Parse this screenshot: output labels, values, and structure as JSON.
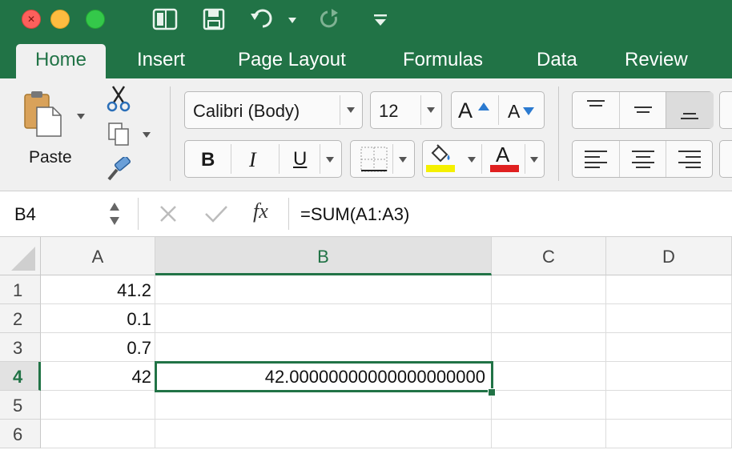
{
  "window": {
    "controls": [
      "close",
      "minimize",
      "maximize"
    ],
    "quick_access": [
      "sidebar-toggle-icon",
      "save-icon",
      "undo-icon",
      "redo-icon",
      "customize-icon"
    ]
  },
  "colors": {
    "accent": "#217346",
    "ribbon_bg": "#f0f0f0",
    "font_color_bar": "#e02020",
    "highlight_bar": "#f5f000"
  },
  "tabs": [
    "Home",
    "Insert",
    "Page Layout",
    "Formulas",
    "Data",
    "Review"
  ],
  "ribbon": {
    "paste_label": "Paste",
    "font_name": "Calibri (Body)",
    "font_size": "12",
    "bold": "B",
    "italic": "I",
    "underline": "U",
    "increase_font": "A",
    "decrease_font": "A",
    "font_color_letter": "A"
  },
  "formula_bar": {
    "name_box": "B4",
    "fx": "fx",
    "formula": "=SUM(A1:A3)"
  },
  "sheet": {
    "columns": [
      "A",
      "B",
      "C",
      "D"
    ],
    "selected_column": "B",
    "rows": [
      "1",
      "2",
      "3",
      "4",
      "5",
      "6"
    ],
    "selected_row": "4",
    "cells": [
      [
        "41.2",
        "",
        "",
        ""
      ],
      [
        "0.1",
        "",
        "",
        ""
      ],
      [
        "0.7",
        "",
        "",
        ""
      ],
      [
        "42",
        "42.00000000000000000000",
        "",
        ""
      ],
      [
        "",
        "",
        "",
        ""
      ]
    ]
  }
}
